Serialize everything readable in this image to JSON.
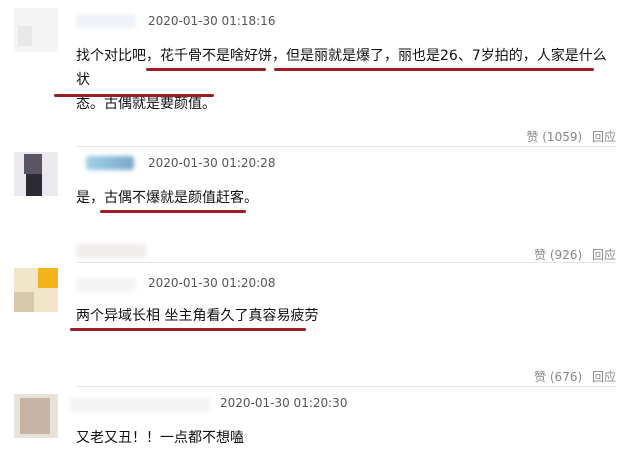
{
  "comments": [
    {
      "time": "2020-01-30 01:18:16",
      "text_line1": "找个对比吧，花千骨不是啥好饼，但是丽就是爆了，丽也是26、7岁拍的，人家是什么状",
      "text_line2": "态。古偶就是要颜值。",
      "likes_label": "赞 (1059)",
      "reply_label": "回应"
    },
    {
      "time": "2020-01-30 01:20:28",
      "text_line1": "是，古偶不爆就是颜值赶客。",
      "likes_label": "赞 (926)",
      "reply_label": "回应"
    },
    {
      "time": "2020-01-30 01:20:08",
      "text_line1": "两个异域长相 坐主角看久了真容易疲劳",
      "likes_label": "赞 (676)",
      "reply_label": "回应"
    },
    {
      "time": "2020-01-30 01:20:30",
      "text_line1": "又老又丑！！一点都不想嗑"
    }
  ],
  "colors": {
    "underline": "#9c1d22",
    "meta": "#555555",
    "action": "#888888"
  }
}
